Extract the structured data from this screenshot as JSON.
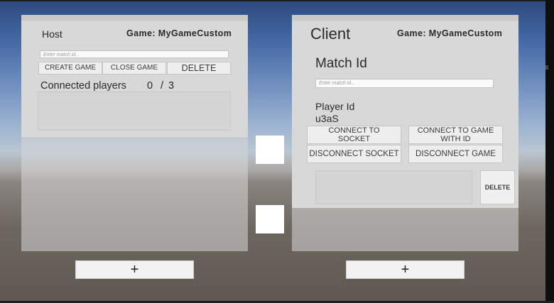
{
  "host": {
    "title": "Host",
    "game_label": "Game: MyGameCustom",
    "match_input_placeholder": "Enter match id...",
    "create_game": "CREATE GAME",
    "close_game": "CLOSE GAME",
    "delete": "DELETE",
    "connected_players_label": "Connected players",
    "connected_count": "0",
    "separator": "/",
    "max_players": "3"
  },
  "client": {
    "title": "Client",
    "game_label": "Game: MyGameCustom",
    "match_id_label": "Match Id",
    "match_input_placeholder": "Enter match id...",
    "player_id_label": "Player Id",
    "player_id_value": "u3aS",
    "connect_socket": "CONNECT TO SOCKET",
    "connect_game": "CONNECT TO GAME WITH ID",
    "disconnect_socket": "DISCONNECT SOCKET",
    "disconnect_game": "DISCONNECT GAME",
    "delete": "DELETE"
  },
  "add_buttons": {
    "left": "+",
    "right": "+"
  }
}
